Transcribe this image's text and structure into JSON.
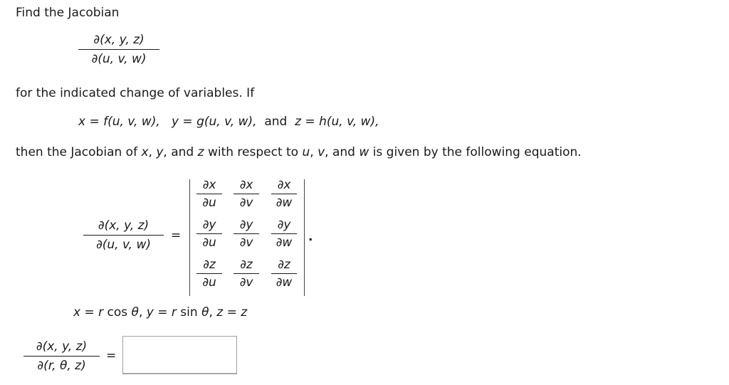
{
  "intro": {
    "line1": "Find the Jacobian",
    "main_fraction": {
      "numerator": "∂(x, y, z)",
      "denominator": "∂(u, v, w)"
    },
    "line2": "for the indicated change of variables. If",
    "definitions": {
      "x_def": "x = f(u, v, w),",
      "y_def": "y = g(u, v, w),",
      "and_word": "and",
      "z_def": "z = h(u, v, w),"
    },
    "line3_parts": {
      "t1": "then the Jacobian of ",
      "v1": "x",
      "t2": ", ",
      "v2": "y",
      "t3": ", and ",
      "v3": "z",
      "t4": " with respect to ",
      "v4": "u",
      "t5": ", ",
      "v5": "v",
      "t6": ", and ",
      "v6": "w",
      "t7": " is given by the following equation."
    }
  },
  "equation": {
    "lhs": {
      "numerator": "∂(x, y, z)",
      "denominator": "∂(u, v, w)"
    },
    "equals": "=",
    "matrix": [
      [
        {
          "num": "∂x",
          "den": "∂u"
        },
        {
          "num": "∂x",
          "den": "∂v"
        },
        {
          "num": "∂x",
          "den": "∂w"
        }
      ],
      [
        {
          "num": "∂y",
          "den": "∂u"
        },
        {
          "num": "∂y",
          "den": "∂v"
        },
        {
          "num": "∂y",
          "den": "∂w"
        }
      ],
      [
        {
          "num": "∂z",
          "den": "∂u"
        },
        {
          "num": "∂z",
          "den": "∂v"
        },
        {
          "num": "∂z",
          "den": "∂w"
        }
      ]
    ],
    "trailing_period": "."
  },
  "problem": {
    "substitution_parts": {
      "a": "x",
      "b": " = ",
      "c": "r",
      "d": " cos ",
      "e": "θ",
      "f": ", ",
      "g": "y",
      "h": " = ",
      "i": "r",
      "j": " sin ",
      "k": "θ",
      "l": ", ",
      "m": "z",
      "n": " = ",
      "o": "z"
    },
    "answer_fraction": {
      "numerator": "∂(x, y, z)",
      "denominator": "∂(r, θ, z)"
    },
    "equals": "=",
    "answer_value": "",
    "answer_placeholder": ""
  }
}
